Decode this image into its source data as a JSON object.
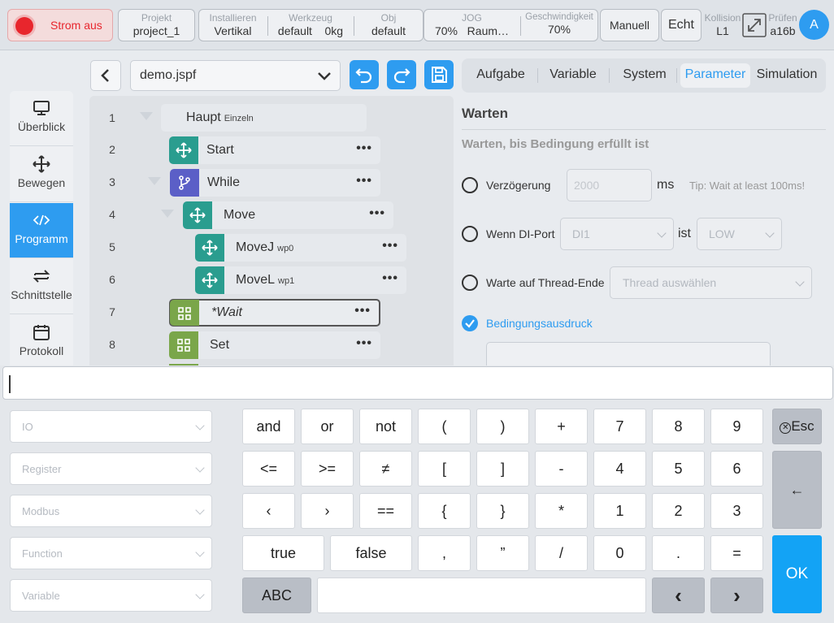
{
  "topbar": {
    "power_label": "Strom aus",
    "project": {
      "label": "Projekt",
      "value": "project_1"
    },
    "install": {
      "label": "Installieren",
      "value": "Vertikal"
    },
    "tool": {
      "label": "Werkzeug",
      "value": "default",
      "load": "0kg"
    },
    "obj": {
      "label": "Obj",
      "value": "default"
    },
    "jog": {
      "label": "JOG",
      "value": "70%",
      "frame": "Raum…"
    },
    "speed": {
      "label": "Geschwindigkeit",
      "value": "70%"
    },
    "mode_label": "Manuell",
    "real_label": "Echt",
    "collision": {
      "label": "Kollision",
      "value": "L1"
    },
    "check": {
      "label": "Prüfen",
      "value": "a16b"
    },
    "avatar_letter": "A",
    "colors": {
      "power_red": "#e8262d",
      "accent_blue": "#2e9cf0"
    }
  },
  "sidebar": {
    "items": [
      {
        "label": "Überblick",
        "icon": "monitor-icon"
      },
      {
        "label": "Bewegen",
        "icon": "move-arrows-icon"
      },
      {
        "label": "Programm",
        "icon": "code-icon",
        "active": true
      },
      {
        "label": "Schnittstelle",
        "icon": "swap-arrows-icon"
      },
      {
        "label": "Protokoll",
        "icon": "calendar-icon"
      }
    ]
  },
  "editor": {
    "filename": "demo.jspf",
    "lines": [
      {
        "num": "1",
        "label": "Haupt",
        "sub": "Einzeln"
      },
      {
        "num": "2",
        "label": "Start",
        "sub": ""
      },
      {
        "num": "3",
        "label": "While",
        "sub": ""
      },
      {
        "num": "4",
        "label": "Move",
        "sub": ""
      },
      {
        "num": "5",
        "label": "MoveJ",
        "sub": "wp0"
      },
      {
        "num": "6",
        "label": "MoveL",
        "sub": "wp1"
      },
      {
        "num": "7",
        "label": "*Wait",
        "sub": ""
      },
      {
        "num": "8",
        "label": "Set",
        "sub": ""
      }
    ]
  },
  "tabs": [
    "Aufgabe",
    "Variable",
    "System",
    "Parameter",
    "Simulation"
  ],
  "active_tab": "Parameter",
  "panel": {
    "title": "Warten",
    "subtitle": "Warten, bis Bedingung erfüllt ist",
    "delay": {
      "label": "Verzögerung",
      "placeholder": "2000",
      "unit": "ms",
      "tip": "Tip: Wait at least 100ms!"
    },
    "di": {
      "label": "Wenn DI-Port",
      "port": "DI1",
      "is_label": "ist",
      "level": "LOW"
    },
    "thread": {
      "label": "Warte auf Thread-Ende",
      "placeholder": "Thread auswählen"
    },
    "condition": {
      "label": "Bedingungsausdruck",
      "checked": true
    }
  },
  "keyboard": {
    "input_value": "",
    "selects": [
      "IO",
      "Register",
      "Modbus",
      "Function",
      "Variable"
    ],
    "row1": [
      "and",
      "or",
      "not",
      "(",
      ")",
      "+",
      "7",
      "8",
      "9"
    ],
    "row2": [
      "<=",
      ">=",
      "≠",
      "[",
      "]",
      "-",
      "4",
      "5",
      "6"
    ],
    "row3": [
      "‹",
      "›",
      "==",
      "{",
      "}",
      "*",
      "1",
      "2",
      "3"
    ],
    "row4": {
      "true": "true",
      "false": "false",
      "comma": ",",
      "quote": "”",
      "slash": "/",
      "zero": "0",
      "dot": ".",
      "eq": "="
    },
    "esc_label": "Esc",
    "backspace": "←",
    "ok_label": "OK",
    "abc_label": "ABC",
    "left_arrow": "‹",
    "right_arrow": "›"
  }
}
